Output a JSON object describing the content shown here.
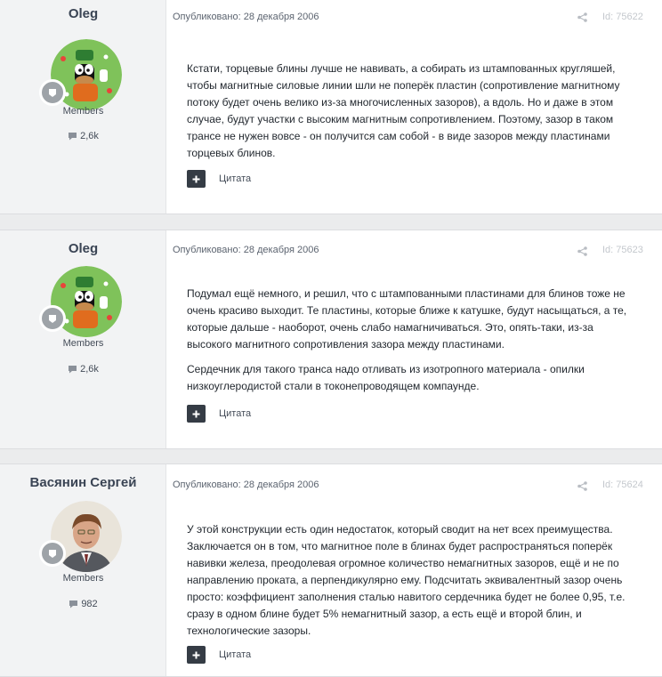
{
  "posts": [
    {
      "author": "Oleg",
      "group": "Members",
      "count": "2,6k",
      "avatar": "goofy-avatar",
      "date": "Опубликовано: 28 декабря 2006",
      "id": "Id: 75622",
      "paragraphs": [
        "Кстати, торцевые блины лучше не навивать, а собирать из штампованных кругляшей, чтобы магнитные силовые линии шли не поперёк пластин (сопротивление магнитному потоку будет очень велико из-за многочисленных зазоров), а вдоль. Но и даже в этом случае, будут участки с высоким магнитным сопротивлением. Поэтому, зазор в таком трансе не нужен вовсе - он получится сам собой - в виде зазоров между пластинами торцевых блинов."
      ],
      "quote": "Цитата"
    },
    {
      "author": "Oleg",
      "group": "Members",
      "count": "2,6k",
      "avatar": "goofy-avatar",
      "date": "Опубликовано: 28 декабря 2006",
      "id": "Id: 75623",
      "paragraphs": [
        "Подумал ещё немного, и решил, что с штампованными пластинами для блинов тоже не очень красиво выходит. Те пластины, которые ближе к катушке, будут насыщаться, а те, которые дальше - наоборот, очень слабо намагничиваться. Это, опять-таки, из-за высокого магнитного сопротивления зазора между пластинами.",
        "Сердечник для такого транса надо отливать из изотропного материала - опилки низкоуглеродистой стали в токонепроводящем компаунде."
      ],
      "quote": "Цитата"
    },
    {
      "author": "Васянин Сергей",
      "group": "Members",
      "count": "982",
      "avatar": "photo-avatar",
      "date": "Опубликовано: 28 декабря 2006",
      "id": "Id: 75624",
      "paragraphs": [
        "У этой конструкции есть один недостаток, который сводит на нет всех преимущества. Заключается он в том, что магнитное поле в блинах будет распространяться поперёк навивки железа, преодолевая огромное количество немагнитных зазоров, ещё и не по направлению проката, а перпендикулярно ему. Подсчитать эквивалентный зазор очень просто: коэффициент заполнения сталью навитого сердечника будет не более 0,95, т.е. сразу в одном блине будет 5% немагнитный зазор, а есть ещё и второй блин, и технологические зазоры."
      ],
      "quote": "Цитата"
    }
  ],
  "icons": {
    "comment": "comment-icon",
    "share": "share-icon",
    "plus": "plus-icon",
    "rank": "rank-badge-icon"
  },
  "colors": {
    "author_panel": "#f2f3f4",
    "quote_button": "#353c45",
    "avatar_green": "#7fc25a"
  }
}
